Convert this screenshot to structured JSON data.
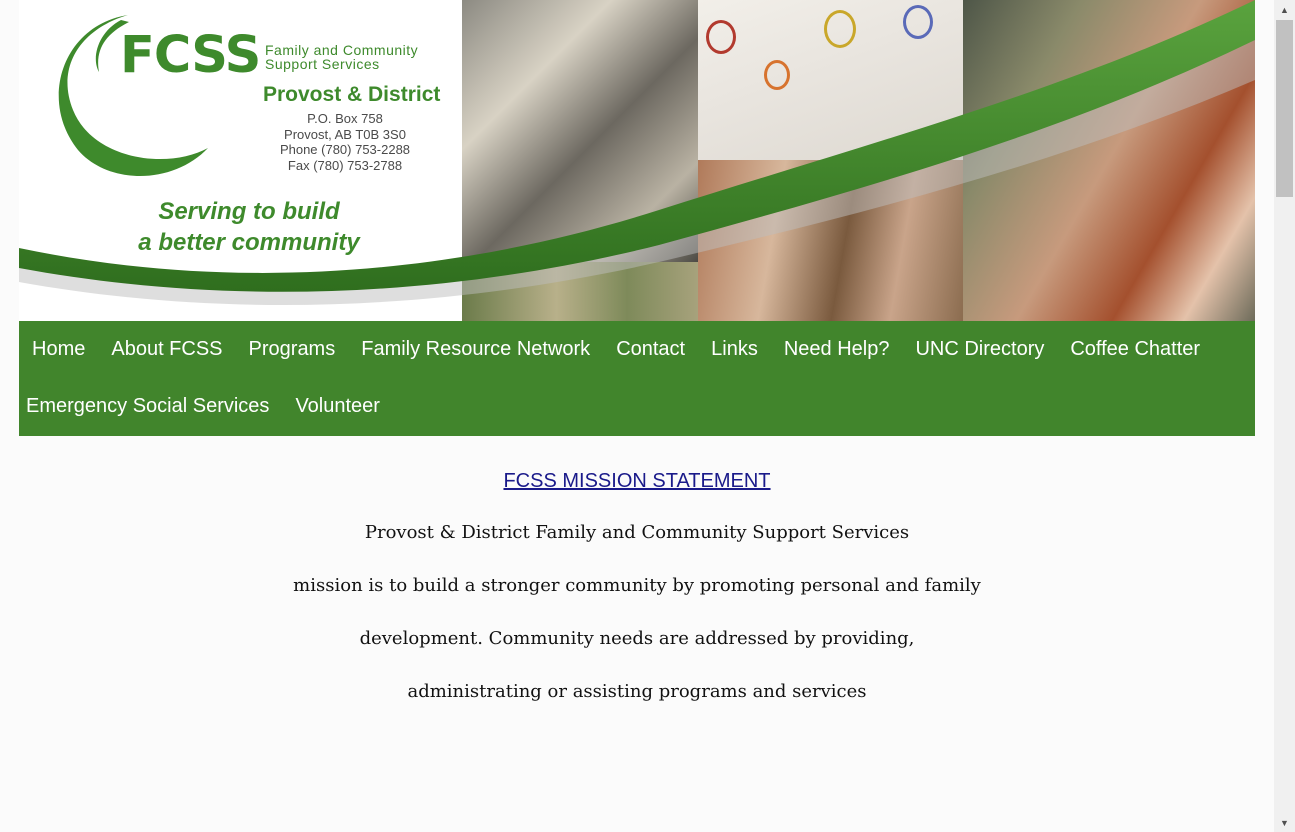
{
  "header": {
    "logo_text": "FCSS",
    "logo_subtitle_line1": "Family and Community",
    "logo_subtitle_line2": "Support Services",
    "district": "Provost & District",
    "address": [
      "P.O. Box 758",
      "Provost, AB   T0B 3S0",
      "Phone (780) 753-2288",
      "Fax (780) 753-2788"
    ],
    "slogan": [
      "Serving to build",
      "a better community"
    ],
    "brand_color": "#41852c"
  },
  "nav": {
    "row1": [
      "Home",
      "About FCSS",
      "Programs",
      "Family Resource Network",
      "Contact",
      "Links",
      "Need Help?",
      "UNC Directory",
      "Coffee Chatter"
    ],
    "row2": [
      "Emergency Social Services",
      "Volunteer"
    ]
  },
  "main": {
    "mission_title": "FCSS MISSION STATEMENT",
    "mission_lines": [
      "Provost & District Family and Community Support Services",
      "mission is to build a stronger community by promoting personal and family",
      "development.  Community needs are addressed by providing,",
      "administrating or assisting programs and services"
    ]
  },
  "scrollbar": {
    "up_icon": "arrow-up-icon",
    "down_icon": "arrow-down-icon"
  }
}
